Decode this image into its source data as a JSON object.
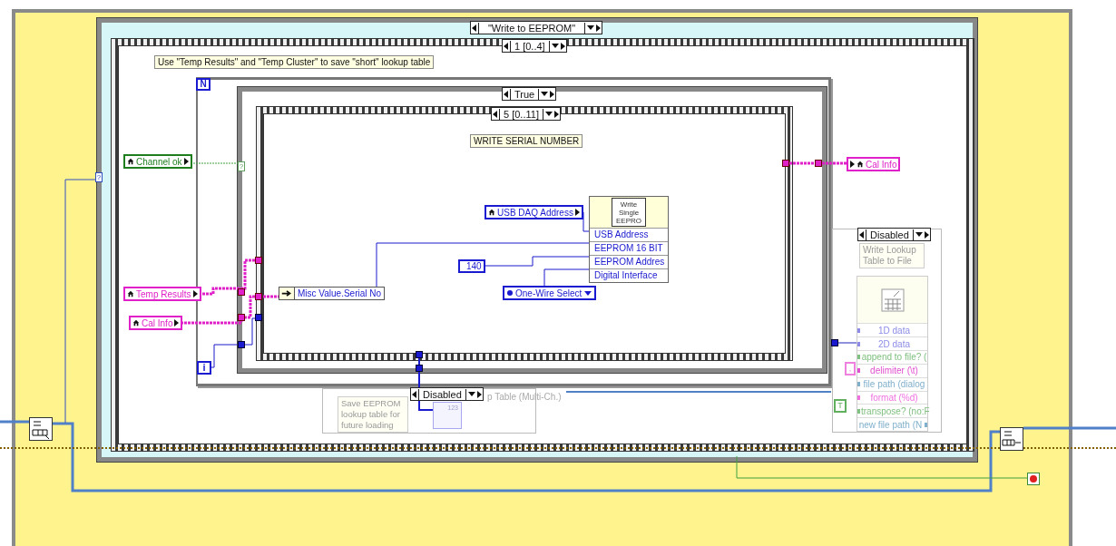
{
  "case_structure": {
    "selector": "\"Write to EEPROM\"",
    "terminal": "?"
  },
  "sequence_outer": {
    "selector": "1 [0..4]"
  },
  "comment": "Use \"Temp Results\" and \"Temp Cluster\" to save \"short\" lookup table",
  "for_loop": {
    "count_terminal": "N",
    "index_terminal": "i"
  },
  "case_inner": {
    "selector": "True",
    "terminal": "?"
  },
  "sequence_inner": {
    "selector": "5 [0..11]",
    "comment": "WRITE SERIAL NUMBER"
  },
  "locals": [
    {
      "label": "Channel ok",
      "kind": "read",
      "color": "#1e7e1e"
    },
    {
      "label": "Temp Results",
      "kind": "read",
      "color": "#e020c8"
    },
    {
      "label": "Cal Info",
      "kind": "read",
      "color": "#e020c8"
    },
    {
      "label": "USB DAQ Address",
      "kind": "read",
      "color": "#1a1ad0"
    },
    {
      "label": "Cal Info",
      "kind": "write",
      "color": "#e020c8"
    }
  ],
  "unbundle": "Misc Value.Serial No",
  "subvi": {
    "icon_lines": [
      "Write",
      "Single",
      "EEPRO"
    ],
    "terminals": [
      "USB Address",
      "EEPROM 16 BIT",
      "EEPROM Addres",
      "Digital Interface"
    ]
  },
  "constant": "140",
  "enum": "One-Wire Select",
  "disabled_left": {
    "selector": "Disabled",
    "comment": "Save EEPROM lookup table for future loading",
    "caption": "p Table (Multi-Ch.)",
    "icon_text": "123"
  },
  "disabled_right": {
    "selector": "Disabled",
    "comment": "Write Lookup Table to File",
    "terminals": [
      {
        "label": "1D data",
        "kind": "input",
        "color": "#8c8ce8"
      },
      {
        "label": "2D data",
        "kind": "input",
        "color": "#8c8ce8"
      },
      {
        "label": "append to file? (",
        "kind": "input",
        "color": "#80c080"
      },
      {
        "label": "delimiter (\\t)",
        "kind": "input",
        "color": "#e050d0"
      },
      {
        "label": "file path (dialog",
        "kind": "input",
        "color": "#80b0cc"
      },
      {
        "label": "format (%d)",
        "kind": "input",
        "color": "#f070e0"
      },
      {
        "label": "transpose? (no:F",
        "kind": "input",
        "color": "#80c080"
      },
      {
        "label": "new file path (N",
        "kind": "output",
        "color": "#80b0cc"
      }
    ],
    "constants": [
      {
        "text": ",",
        "color": "#f080e0"
      },
      {
        "text": "T",
        "color": "#60b060"
      }
    ]
  }
}
